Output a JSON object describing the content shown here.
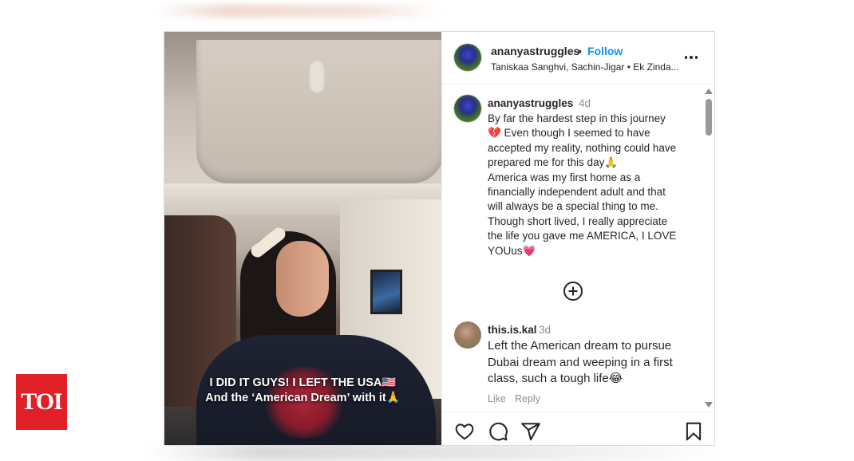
{
  "watermark": {
    "brand": "TOI",
    "color": "#e11f26"
  },
  "media": {
    "caption_line1": "I DID IT GUYS! I LEFT THE USA🇺🇸",
    "caption_line2": "And the ‘American Dream’ with it🙏"
  },
  "header": {
    "username": "ananyastruggles",
    "separator": "•",
    "follow_label": "Follow",
    "audio": "Taniskaa Sanghvi, Sachin-Jigar • Ek Zinda...",
    "more_icon": "more-horizontal-icon"
  },
  "caption_comment": {
    "username": "ananyastruggles",
    "time": "4d",
    "text": "By far the hardest step in this journey\n💔 Even though I seemed to have\naccepted my reality, nothing could have\nprepared me for this day🙏\nAmerica was my first home as a\nfinancially independent adult and that\nwill always be a special thing to me.\nThough short lived, I really appreciate\nthe life you gave me AMERICA, I LOVE\nYOUus💗"
  },
  "comments": [
    {
      "username": "this.is.kal",
      "time": "3d",
      "text": "Left the American dream to pursue\nDubai dream and weeping in a first\nclass, such a tough life😂",
      "like_label": "Like",
      "reply_label": "Reply"
    }
  ],
  "actions": {
    "icons": [
      "heart-icon",
      "comment-icon",
      "share-icon",
      "bookmark-icon"
    ]
  },
  "colors": {
    "accent": "#0095f6",
    "text": "#262626",
    "muted": "#8e8e8e"
  }
}
